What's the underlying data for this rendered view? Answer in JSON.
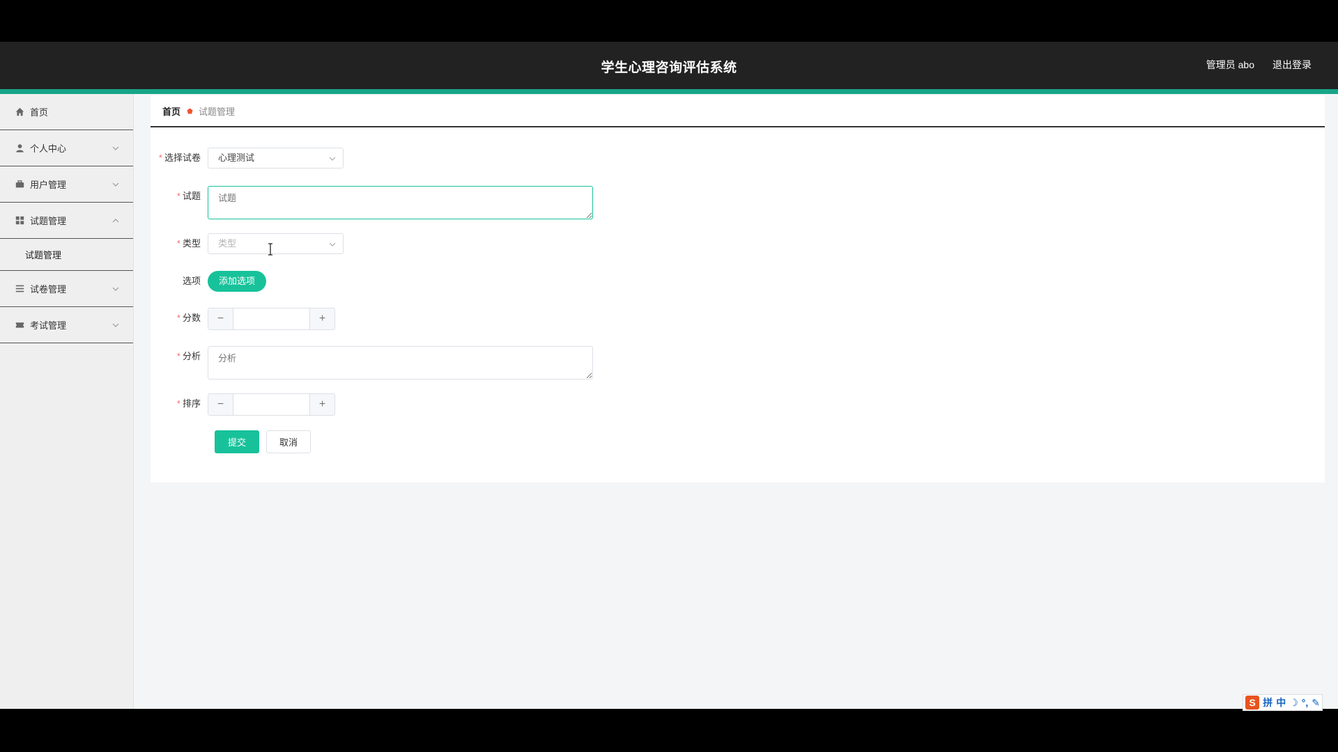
{
  "header": {
    "title": "学生心理咨询评估系统",
    "user": "管理员 abo",
    "logout": "退出登录"
  },
  "sidebar": {
    "items": [
      {
        "label": "首页",
        "icon": "home-icon"
      },
      {
        "label": "个人中心",
        "icon": "user-icon"
      },
      {
        "label": "用户管理",
        "icon": "briefcase-icon"
      },
      {
        "label": "试题管理",
        "icon": "grid-icon",
        "expanded": true
      },
      {
        "label": "试卷管理",
        "icon": "list-icon"
      },
      {
        "label": "考试管理",
        "icon": "ticket-icon"
      }
    ],
    "submenu": [
      "试题管理"
    ]
  },
  "breadcrumb": {
    "home": "首页",
    "current": "试题管理"
  },
  "form": {
    "paper": {
      "label": "选择试卷",
      "value": "心理测试"
    },
    "question": {
      "label": "试题",
      "placeholder": "试题"
    },
    "type": {
      "label": "类型",
      "placeholder": "类型"
    },
    "options": {
      "label": "选项",
      "button": "添加选项"
    },
    "score": {
      "label": "分数",
      "value": ""
    },
    "analysis": {
      "label": "分析",
      "placeholder": "分析"
    },
    "order": {
      "label": "排序",
      "value": ""
    },
    "submit": "提交",
    "cancel": "取消",
    "required_mark": "*"
  },
  "ime": {
    "logo": "S",
    "items": [
      "拼",
      "中",
      "☽",
      "°,",
      "✎"
    ]
  },
  "colors": {
    "accent": "#17c29a",
    "header_bg": "#222222",
    "header_stripe": "#17a589",
    "required": "#f56c6c"
  }
}
